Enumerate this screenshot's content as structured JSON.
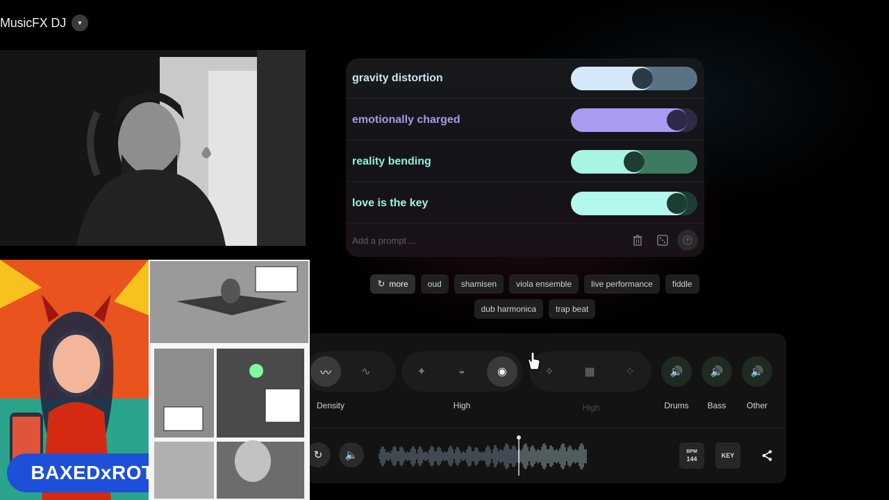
{
  "app": {
    "title": "MusicFX DJ"
  },
  "prompts": [
    {
      "label": "gravity distortion",
      "level": 0.58,
      "label_color": "#cfe3f5",
      "track_color": "#5a7384",
      "fill_color": "#d4e8fa",
      "knob_color": "#2b3b45"
    },
    {
      "label": "emotionally charged",
      "level": 0.92,
      "label_color": "#a79ae6",
      "track_color": "#2d2a48",
      "fill_color": "#a89cf0",
      "knob_color": "#2e2946"
    },
    {
      "label": "reality bending",
      "level": 0.5,
      "label_color": "#8ef0dc",
      "track_color": "#3d7a62",
      "fill_color": "#a8f5e4",
      "knob_color": "#1d3d33"
    },
    {
      "label": "love is the key",
      "level": 0.92,
      "label_color": "#9ff5e6",
      "track_color": "#1d3d33",
      "fill_color": "#b2f8ec",
      "knob_color": "#1d3d33"
    }
  ],
  "add_prompt": {
    "placeholder": "Add a prompt ..."
  },
  "suggestions": {
    "more_label": "more",
    "chips": [
      "oud",
      "shamisen",
      "viola ensemble",
      "live performance",
      "fiddle",
      "dub harmonica",
      "trap beat"
    ]
  },
  "controls": {
    "density_label": "Density",
    "brightness_label": "High",
    "dim_label": "High",
    "instruments": [
      "Drums",
      "Bass",
      "Other"
    ]
  },
  "transport": {
    "bpm_label": "BPM",
    "bpm_value": "144",
    "key_label": "KEY",
    "playhead_position": 0.67
  },
  "overlay": {
    "badge_text": "BAXEDxROT"
  },
  "icons": {
    "dropdown": "chevron-down-icon",
    "delete": "trash-icon",
    "dice": "dice-icon",
    "send": "send-icon",
    "refresh": "refresh-icon",
    "speaker": "speaker-icon",
    "share": "share-icon"
  }
}
